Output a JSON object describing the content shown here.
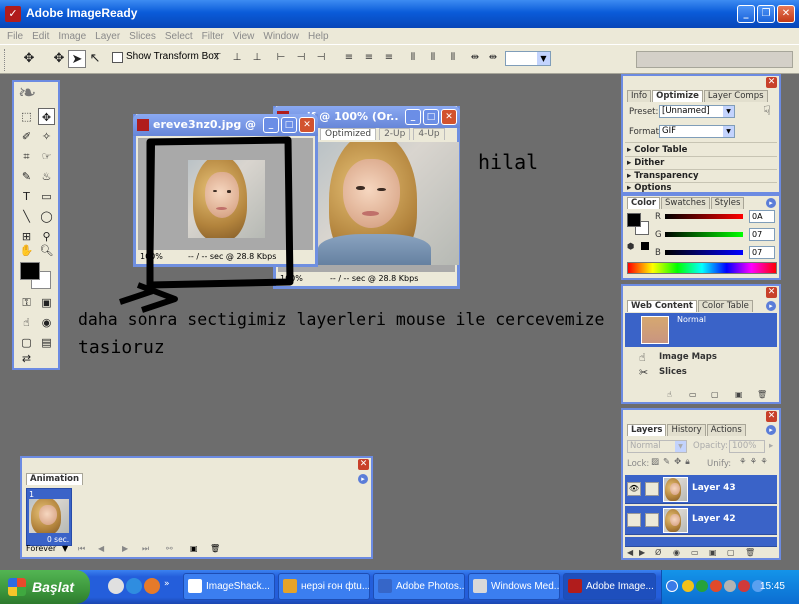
{
  "app": {
    "title": "Adobe ImageReady"
  },
  "menu": [
    "File",
    "Edit",
    "Image",
    "Layer",
    "Slices",
    "Select",
    "Filter",
    "View",
    "Window",
    "Help"
  ],
  "options_bar": {
    "show_transform_box": "Show Transform Box"
  },
  "doc1": {
    "title": "ereve3nz0.jpg @ 10...",
    "zoom": "100%",
    "status": "-- / -- sec @ 28.8 Kbps"
  },
  "doc2": {
    "title": "gif @ 100% (Or...",
    "tabs": [
      "Optimized",
      "2-Up",
      "4-Up"
    ],
    "zoom": "100%",
    "status": "-- / -- sec @ 28.8 Kbps"
  },
  "optimize_panel": {
    "tabs": [
      "Info",
      "Optimize",
      "Layer Comps"
    ],
    "preset_label": "Preset:",
    "preset_value": "[Unnamed]",
    "format_label": "Format:",
    "format_value": "GIF",
    "sections": [
      "Color Table",
      "Dither",
      "Transparency",
      "Options"
    ]
  },
  "color_panel": {
    "tabs": [
      "Color",
      "Swatches",
      "Styles"
    ],
    "r_label": "R",
    "g_label": "G",
    "b_label": "B",
    "r_value": "0A",
    "g_value": "07",
    "b_value": "07"
  },
  "web_panel": {
    "tabs": [
      "Web Content",
      "Color Table"
    ],
    "normal": "Normal",
    "image_maps": "Image Maps",
    "slices": "Slices"
  },
  "layers_panel": {
    "tabs": [
      "Layers",
      "History",
      "Actions"
    ],
    "blend": "Normal",
    "opacity_label": "Opacity:",
    "opacity_value": "100%",
    "lock_label": "Lock:",
    "unify_label": "Unify:",
    "layers": [
      "Layer 43",
      "Layer 42"
    ]
  },
  "animation_panel": {
    "tab": "Animation",
    "frame_number": "1",
    "frame_delay": "0 sec.",
    "loop": "Forever"
  },
  "annotations": {
    "name": "hilal",
    "instruction_line1": "daha sonra sectigimiz layerleri mouse ile cercevemize",
    "instruction_line2": "tasioruz"
  },
  "taskbar": {
    "start": "Başlat",
    "tasks": [
      "ImageShack...",
      "нерэі ғон фtu...",
      "Adobe Photos...",
      "Windows Med...",
      "Adobe Image..."
    ],
    "clock": "15:45"
  }
}
